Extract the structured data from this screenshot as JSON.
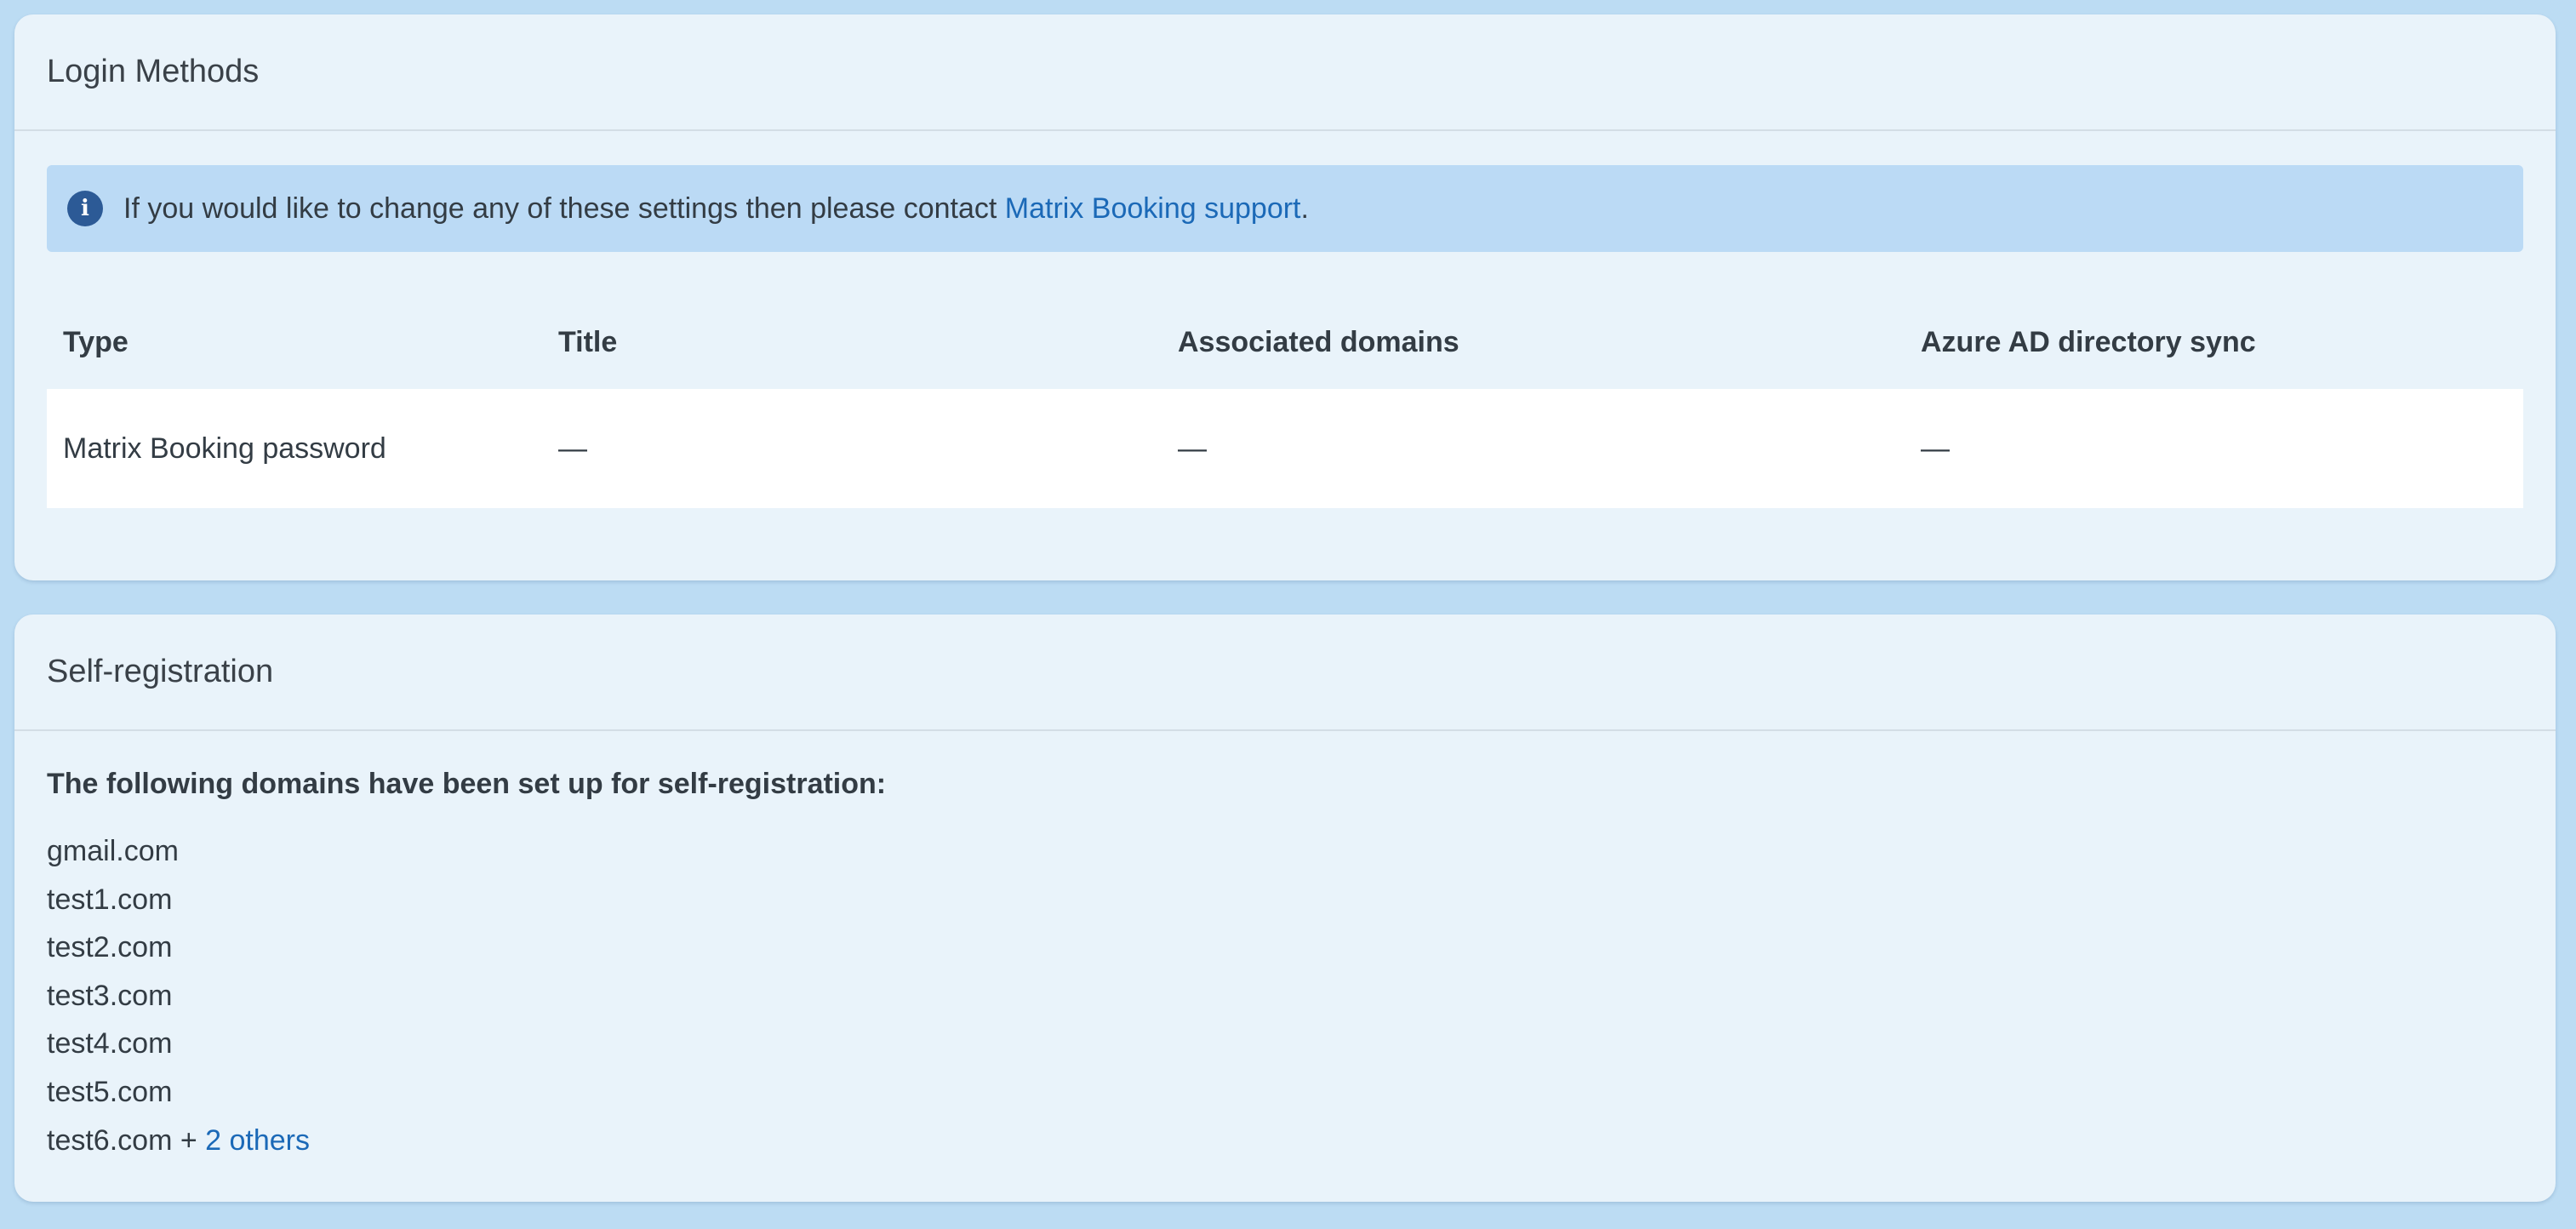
{
  "login_methods": {
    "title": "Login Methods",
    "info_banner": {
      "icon": "info-icon",
      "text": "If you would like to change any of these settings then please contact",
      "link_text": "Matrix Booking support",
      "suffix": "."
    },
    "table": {
      "headers": [
        "Type",
        "Title",
        "Associated domains",
        "Azure AD directory sync"
      ],
      "rows": [
        {
          "type": "Matrix Booking password",
          "title": "—",
          "associated_domains": "—",
          "azure_sync": "—"
        }
      ]
    }
  },
  "self_registration": {
    "title": "Self-registration",
    "intro": "The following domains have been set up for self-registration:",
    "domains": [
      "gmail.com",
      "test1.com",
      "test2.com",
      "test3.com",
      "test4.com",
      "test5.com",
      "test6.com"
    ],
    "more_prefix": " + ",
    "more_link": "2 others"
  },
  "colors": {
    "page_background": "#bcdcf3",
    "card_background": "#e9f3fa",
    "banner_background": "#bbdaf5",
    "link": "#1b69b7",
    "info_icon": "#2c5a96",
    "text": "#333c44"
  }
}
